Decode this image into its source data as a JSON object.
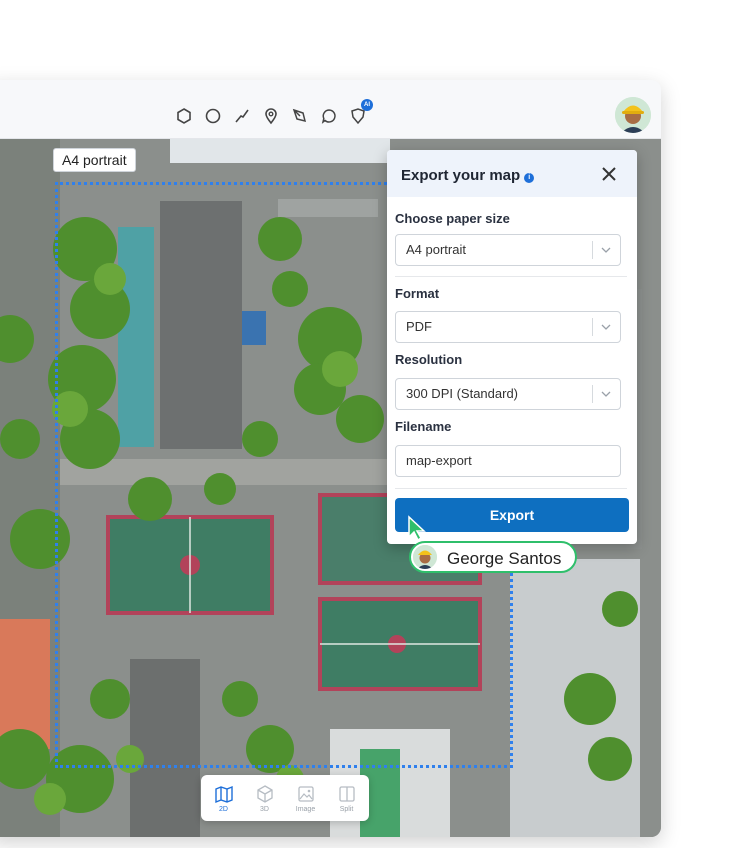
{
  "toolbar": {
    "tools": [
      "polygon-icon",
      "circle-icon",
      "line-icon",
      "pin-icon",
      "pen-icon",
      "comment-icon",
      "ai-shield-icon"
    ],
    "ai_badge": "AI"
  },
  "map": {
    "paper_label": "A4 portrait"
  },
  "export_panel": {
    "title": "Export your map",
    "info": "i",
    "paper_size_label": "Choose paper size",
    "paper_size_value": "A4 portrait",
    "format_label": "Format",
    "format_value": "PDF",
    "resolution_label": "Resolution",
    "resolution_value": "300 DPI (Standard)",
    "filename_label": "Filename",
    "filename_value": "map-export",
    "export_label": "Export"
  },
  "collaborator": {
    "name": "George Santos"
  },
  "view_toggle": {
    "items": [
      {
        "label": "2D",
        "active": true
      },
      {
        "label": "3D",
        "active": false
      },
      {
        "label": "Image",
        "active": false
      },
      {
        "label": "Split",
        "active": false
      }
    ]
  },
  "colors": {
    "accent": "#1e6fd9",
    "button": "#0e6fc0",
    "presence": "#2fbf6b"
  }
}
